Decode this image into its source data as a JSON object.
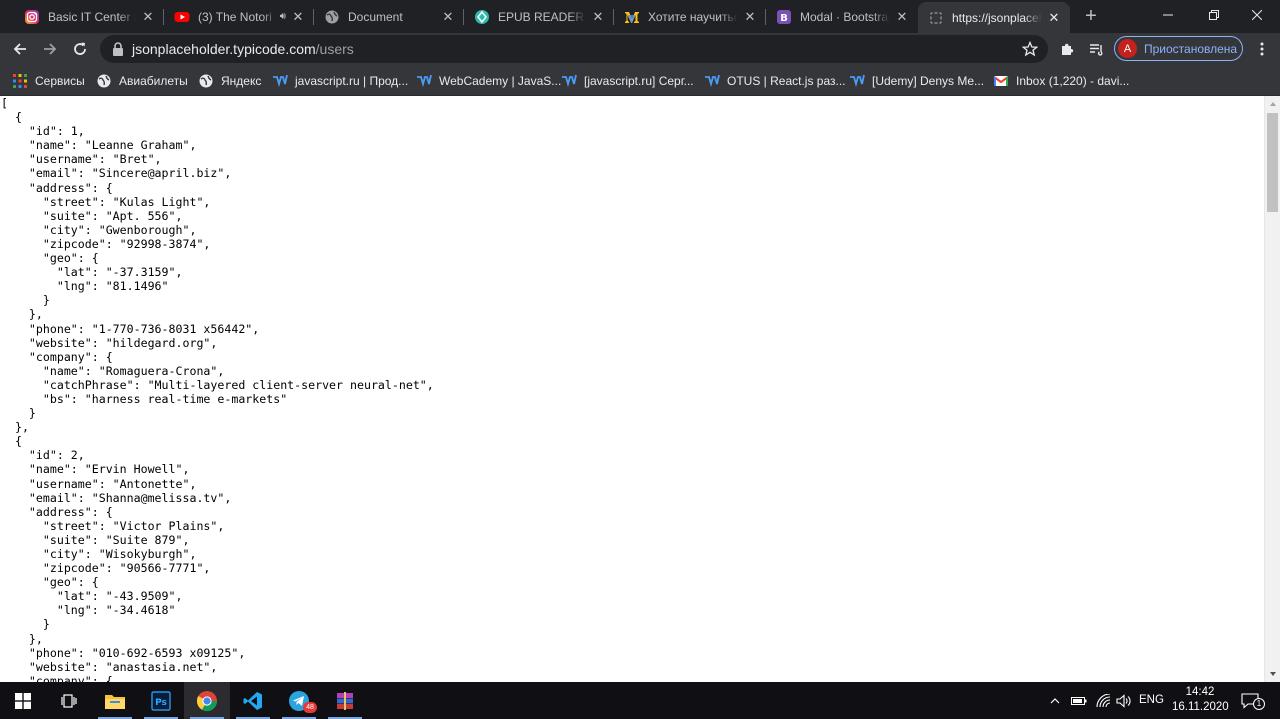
{
  "browser": {
    "tabs": [
      {
        "title": "Basic IT Center (@",
        "icon": "instagram-icon"
      },
      {
        "title": "(3) The Notori",
        "icon": "youtube-icon",
        "audio": true
      },
      {
        "title": "Document",
        "icon": "globe-icon"
      },
      {
        "title": "EPUB READER",
        "icon": "epub-icon"
      },
      {
        "title": "Хотите научиться",
        "icon": "medium-icon"
      },
      {
        "title": "Modal · Bootstrap",
        "icon": "bootstrap-icon"
      },
      {
        "title": "https://jsonplaceh",
        "icon": "page-icon",
        "active": true
      }
    ],
    "url_host": "jsonplaceholder.typicode.com",
    "url_path": "/users",
    "profile_initial": "А",
    "profile_status": "Приостановлена",
    "bookmarks": [
      {
        "label": "Сервисы",
        "icon": "apps-grid-icon"
      },
      {
        "label": "Авиабилеты",
        "icon": "globe-icon"
      },
      {
        "label": "Яндекс",
        "icon": "globe-icon"
      },
      {
        "label": "javascript.ru | Прод...",
        "icon": "webcademy-icon"
      },
      {
        "label": "WebCademy | JavaS...",
        "icon": "webcademy-icon"
      },
      {
        "label": "[javascript.ru] Серг...",
        "icon": "webcademy-icon"
      },
      {
        "label": "OTUS | React.js раз...",
        "icon": "webcademy-icon"
      },
      {
        "label": "[Udemy] Denys Me...",
        "icon": "webcademy-icon"
      },
      {
        "label": "Inbox (1,220) - davi...",
        "icon": "gmail-icon"
      }
    ]
  },
  "content_lines": [
    "[",
    "  {",
    "    \"id\": 1,",
    "    \"name\": \"Leanne Graham\",",
    "    \"username\": \"Bret\",",
    "    \"email\": \"Sincere@april.biz\",",
    "    \"address\": {",
    "      \"street\": \"Kulas Light\",",
    "      \"suite\": \"Apt. 556\",",
    "      \"city\": \"Gwenborough\",",
    "      \"zipcode\": \"92998-3874\",",
    "      \"geo\": {",
    "        \"lat\": \"-37.3159\",",
    "        \"lng\": \"81.1496\"",
    "      }",
    "    },",
    "    \"phone\": \"1-770-736-8031 x56442\",",
    "    \"website\": \"hildegard.org\",",
    "    \"company\": {",
    "      \"name\": \"Romaguera-Crona\",",
    "      \"catchPhrase\": \"Multi-layered client-server neural-net\",",
    "      \"bs\": \"harness real-time e-markets\"",
    "    }",
    "  },",
    "  {",
    "    \"id\": 2,",
    "    \"name\": \"Ervin Howell\",",
    "    \"username\": \"Antonette\",",
    "    \"email\": \"Shanna@melissa.tv\",",
    "    \"address\": {",
    "      \"street\": \"Victor Plains\",",
    "      \"suite\": \"Suite 879\",",
    "      \"city\": \"Wisokyburgh\",",
    "      \"zipcode\": \"90566-7771\",",
    "      \"geo\": {",
    "        \"lat\": \"-43.9509\",",
    "        \"lng\": \"-34.4618\"",
    "      }",
    "    },",
    "    \"phone\": \"010-692-6593 x09125\",",
    "    \"website\": \"anastasia.net\",",
    "    \"company\": {"
  ],
  "taskbar": {
    "apps": [
      "windows-start-icon",
      "task-view-icon",
      "file-explorer-icon",
      "photoshop-icon",
      "chrome-icon",
      "vscode-icon",
      "telegram-icon",
      "winrar-icon"
    ],
    "telegram_badge": "48",
    "language": "ENG",
    "time": "14:42",
    "date": "16.11.2020",
    "notification_count": "1"
  },
  "colors": {
    "tabstrip": "#202124",
    "toolbar": "#35363a",
    "accent": "#8ab4f8",
    "taskbar": "#101014"
  }
}
